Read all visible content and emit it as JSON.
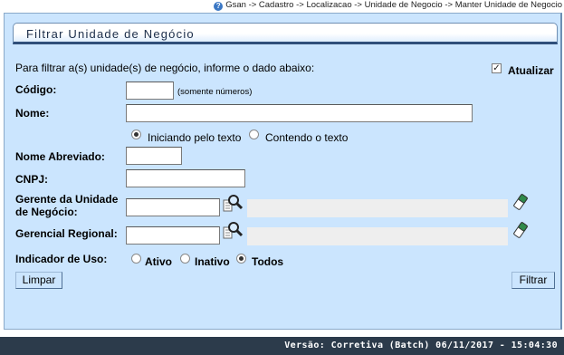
{
  "breadcrumb": "Gsan -> Cadastro -> Localizacao -> Unidade de Negocio -> Manter Unidade de Negocio",
  "title": "Filtrar Unidade de Negócio",
  "instruction": "Para filtrar a(s) unidade(s) de negócio, informe o dado abaixo:",
  "atualizar": {
    "label": "Atualizar",
    "checked": true
  },
  "codigo": {
    "label": "Código:",
    "value": "",
    "hint": "(somente números)"
  },
  "nome": {
    "label": "Nome:",
    "value": "",
    "option_iniciando": "Iniciando pelo texto",
    "option_contendo": "Contendo o texto",
    "selected": "iniciando"
  },
  "nome_abreviado": {
    "label": "Nome Abreviado:",
    "value": ""
  },
  "cnpj": {
    "label": "CNPJ:",
    "value": ""
  },
  "gerente": {
    "label_line1": "Gerente da Unidade",
    "label_line2": "de Negócio:",
    "code": "",
    "name": ""
  },
  "gerencial_regional": {
    "label": "Gerencial Regional:",
    "code": "",
    "name": ""
  },
  "indicador_uso": {
    "label": "Indicador de Uso:",
    "option_ativo": "Ativo",
    "option_inativo": "Inativo",
    "option_todos": "Todos",
    "selected": "todos"
  },
  "buttons": {
    "limpar": "Limpar",
    "filtrar": "Filtrar"
  },
  "footer": "Versão: Corretiva (Batch) 06/11/2017 - 15:04:30",
  "colors": {
    "panel": "#cbe5fe",
    "footer": "#2c3b4b",
    "border": "#6f8fb3"
  }
}
